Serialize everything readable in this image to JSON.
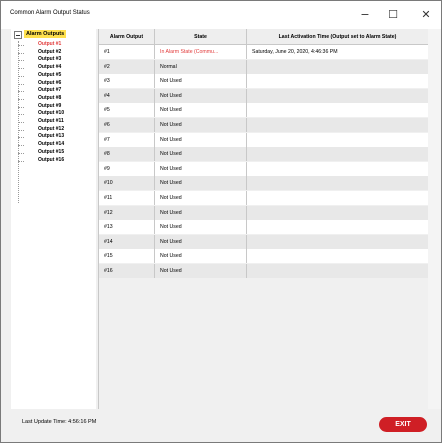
{
  "window": {
    "title": "Common Alarm Output Status",
    "minimize_glyph": "−",
    "maximize_glyph": "☐",
    "close_glyph": "✕"
  },
  "tree": {
    "root_label": "Alarm Outputs",
    "selected_index": 0,
    "items": [
      "Output #1",
      "Output #2",
      "Output #3",
      "Output #4",
      "Output #5",
      "Output #6",
      "Output #7",
      "Output #8",
      "Output #9",
      "Output #10",
      "Output #11",
      "Output #12",
      "Output #13",
      "Output #14",
      "Output #15",
      "Output #16"
    ]
  },
  "table": {
    "columns": [
      "Alarm Output",
      "State",
      "Last Activation Time (Output set to Alarm State)"
    ],
    "rows": [
      {
        "output": "#1",
        "state": "In Alarm State (Commu...",
        "time": "Saturday, June 20, 2020, 4:46:36 PM",
        "alarm": true
      },
      {
        "output": "#2",
        "state": "Normal",
        "time": "",
        "alarm": false
      },
      {
        "output": "#3",
        "state": "Not Used",
        "time": "",
        "alarm": false
      },
      {
        "output": "#4",
        "state": "Not Used",
        "time": "",
        "alarm": false
      },
      {
        "output": "#5",
        "state": "Not Used",
        "time": "",
        "alarm": false
      },
      {
        "output": "#6",
        "state": "Not Used",
        "time": "",
        "alarm": false
      },
      {
        "output": "#7",
        "state": "Not Used",
        "time": "",
        "alarm": false
      },
      {
        "output": "#8",
        "state": "Not Used",
        "time": "",
        "alarm": false
      },
      {
        "output": "#9",
        "state": "Not Used",
        "time": "",
        "alarm": false
      },
      {
        "output": "#10",
        "state": "Not Used",
        "time": "",
        "alarm": false
      },
      {
        "output": "#11",
        "state": "Not Used",
        "time": "",
        "alarm": false
      },
      {
        "output": "#12",
        "state": "Not Used",
        "time": "",
        "alarm": false
      },
      {
        "output": "#13",
        "state": "Not Used",
        "time": "",
        "alarm": false
      },
      {
        "output": "#14",
        "state": "Not Used",
        "time": "",
        "alarm": false
      },
      {
        "output": "#15",
        "state": "Not Used",
        "time": "",
        "alarm": false
      },
      {
        "output": "#16",
        "state": "Not Used",
        "time": "",
        "alarm": false
      }
    ]
  },
  "footer": {
    "last_update": "Last Update Time: 4:56:16 PM",
    "exit_label": "EXIT"
  },
  "colors": {
    "alarm_text": "#e23b3b",
    "selection_highlight": "#ffe04d",
    "exit_button": "#cf1f25"
  }
}
